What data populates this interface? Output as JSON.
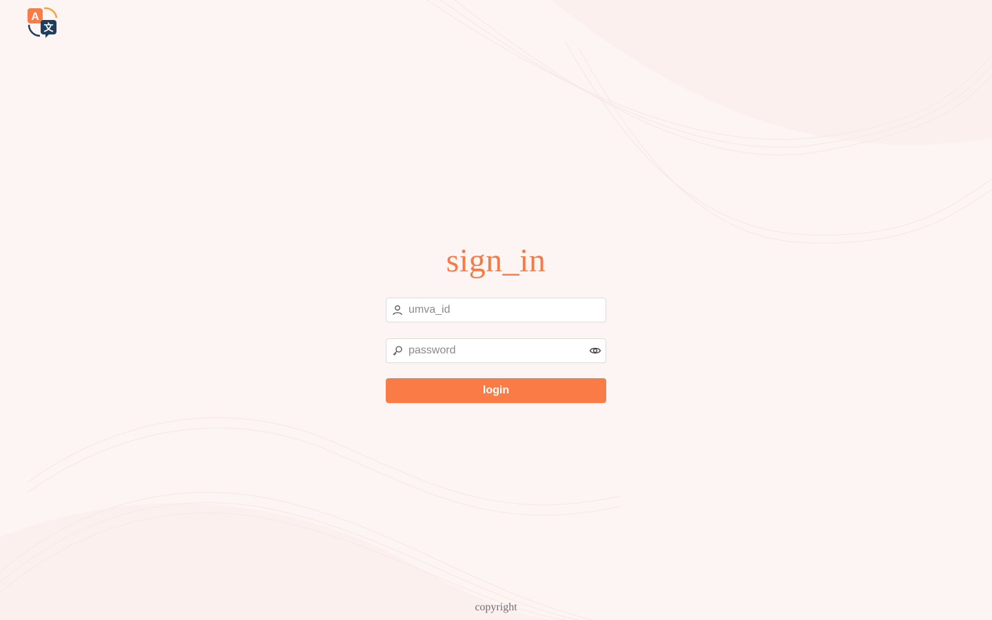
{
  "brand": {
    "logo_icon": "translate-icon",
    "accent_color": "#f97b45",
    "dark_color": "#1f3d5c"
  },
  "login": {
    "title": "sign_in",
    "username_placeholder": "umva_id",
    "username_icon": "user-icon",
    "password_placeholder": "password",
    "password_icon": "key-icon",
    "password_toggle_icon": "eye-icon",
    "submit_label": "login"
  },
  "footer": {
    "copyright": "copyright"
  }
}
